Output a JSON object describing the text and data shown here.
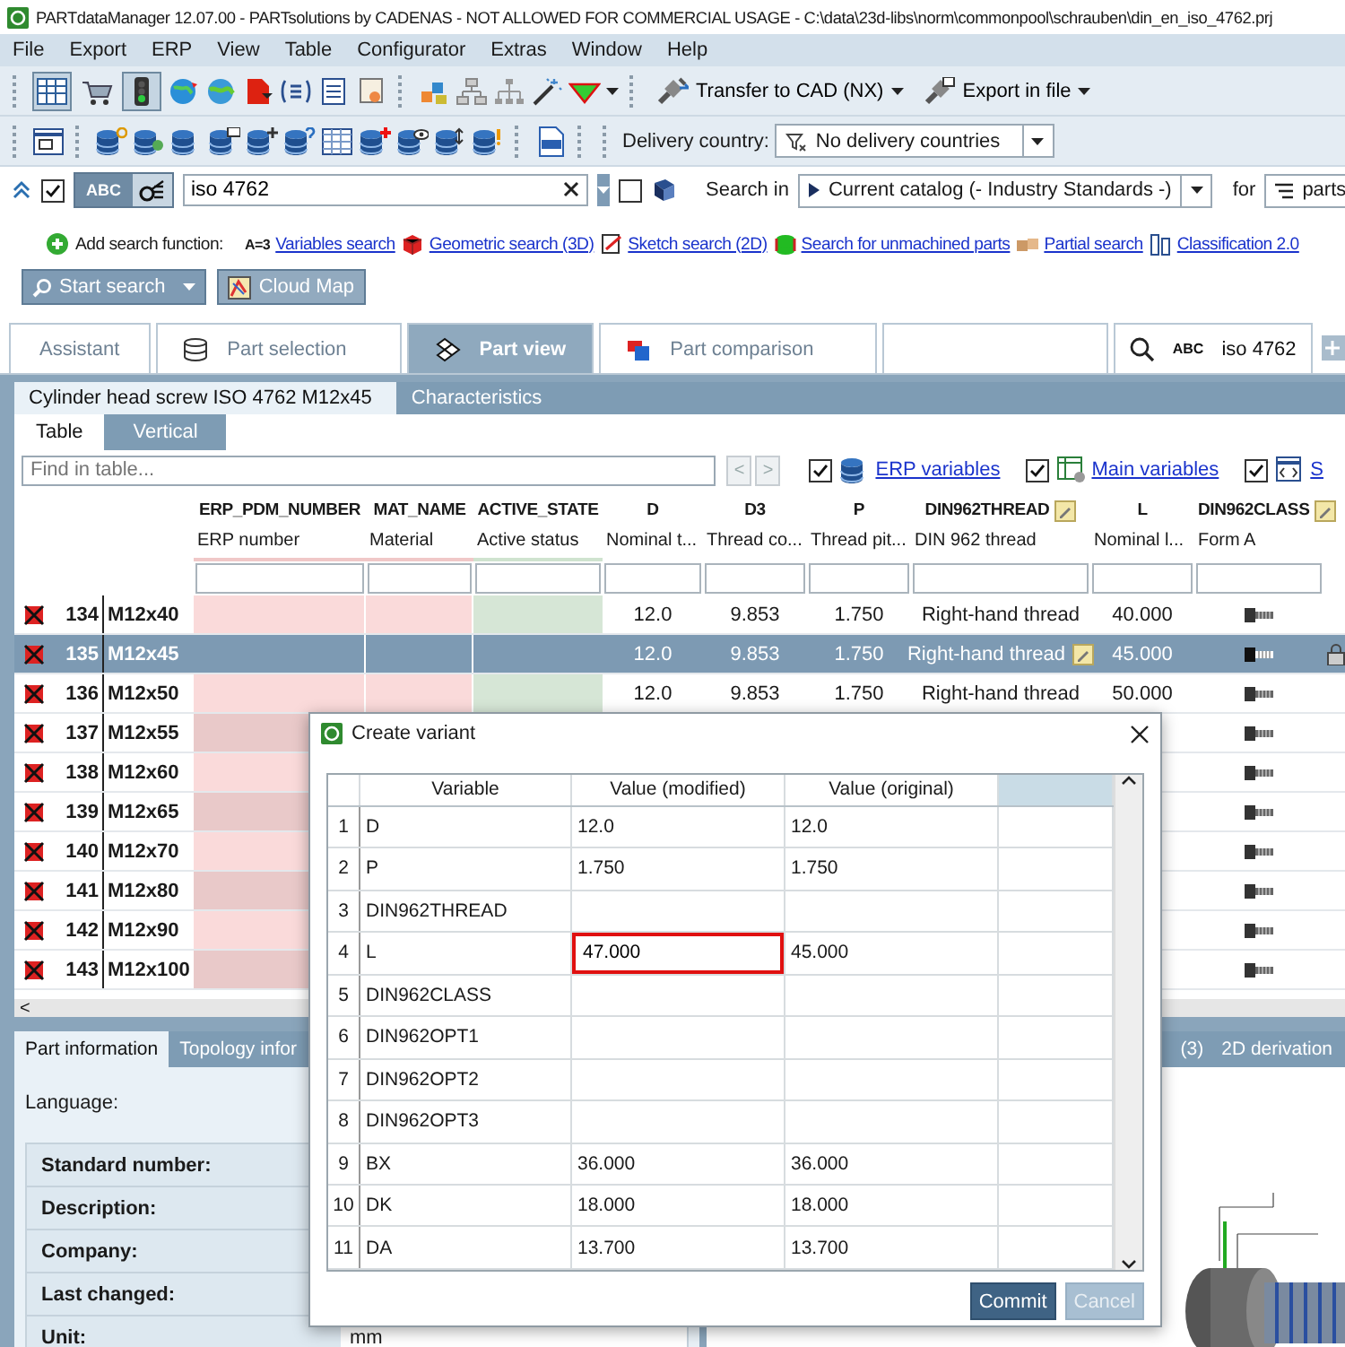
{
  "window": {
    "title": "PARTdataManager 12.07.00 - PARTsolutions by CADENAS - NOT ALLOWED FOR COMMERCIAL USAGE - C:\\data\\23d-libs\\norm\\commonpool\\schrauben\\din_en_iso_4762.prj"
  },
  "menu": [
    "File",
    "Export",
    "ERP",
    "View",
    "Table",
    "Configurator",
    "Extras",
    "Window",
    "Help"
  ],
  "toolbar": {
    "toggles": [
      {
        "pressed": true
      },
      {
        "pressed": false
      },
      {
        "pressed": true
      }
    ],
    "transfer_button": "Transfer to CAD (NX)",
    "export_button": "Export in file",
    "delivery_label": "Delivery country:",
    "delivery_value": "No delivery countries"
  },
  "search": {
    "checked": true,
    "abc_label": "ABC",
    "query": "iso 4762",
    "option_checked": false,
    "search_in_label": "Search in",
    "catalog": "Current catalog (- Industry Standards -)",
    "for_label": "for",
    "for_value": "parts"
  },
  "search_functions": {
    "label": "Add search function:",
    "links": [
      {
        "kind": "variables",
        "icon_text": "A=3",
        "label": "Variables search"
      },
      {
        "kind": "geometric",
        "label": "Geometric search (3D)"
      },
      {
        "kind": "sketch",
        "label": "Sketch search (2D)"
      },
      {
        "kind": "unmachined",
        "label": "Search for unmachined parts"
      },
      {
        "kind": "partial",
        "label": "Partial search"
      },
      {
        "kind": "classification",
        "label": "Classification 2.0"
      }
    ]
  },
  "action_buttons": [
    {
      "kind": "search",
      "label": "Start search"
    },
    {
      "kind": "map",
      "label": "Cloud Map"
    }
  ],
  "main_tabs": [
    {
      "kind": "text",
      "label": "Assistant",
      "selected": false
    },
    {
      "kind": "selection",
      "label": "Part selection",
      "selected": false
    },
    {
      "kind": "view",
      "label": "Part view",
      "selected": true
    },
    {
      "kind": "comparison",
      "label": "Part comparison",
      "selected": false
    },
    {
      "kind": "blank",
      "selected": false
    },
    {
      "kind": "search",
      "prefix": "ABC",
      "label": "iso 4762",
      "selected": false
    }
  ],
  "part_tabs": [
    {
      "label": "Cylinder head screw ISO 4762 M12x45",
      "selected": true
    },
    {
      "label": "Characteristics",
      "selected": false
    }
  ],
  "view_tabs": [
    {
      "label": "Table",
      "selected": true
    },
    {
      "label": "Vertical",
      "selected": false
    }
  ],
  "find": {
    "placeholder": "Find in table...",
    "prev": "<",
    "next": ">"
  },
  "filters": [
    {
      "kind": "erp",
      "label": "ERP variables",
      "checked": true
    },
    {
      "kind": "main",
      "label": "Main variables",
      "checked": true
    },
    {
      "kind": "code",
      "label": "S",
      "checked": true
    }
  ],
  "table": {
    "columns": [
      {
        "name": "ERP_PDM_NUMBER",
        "subtitle": "ERP number",
        "kind": "erp",
        "editable": false
      },
      {
        "name": "MAT_NAME",
        "subtitle": "Material",
        "kind": "erp",
        "editable": false
      },
      {
        "name": "ACTIVE_STATE",
        "subtitle": "Active status",
        "kind": "state",
        "editable": false
      },
      {
        "name": "D",
        "subtitle": "Nominal t...",
        "kind": "value",
        "editable": false
      },
      {
        "name": "D3",
        "subtitle": "Thread co...",
        "kind": "value",
        "editable": false
      },
      {
        "name": "P",
        "subtitle": "Thread pit...",
        "kind": "value",
        "editable": false
      },
      {
        "name": "DIN962THREAD",
        "subtitle": "DIN 962 thread",
        "kind": "value",
        "editable": true
      },
      {
        "name": "L",
        "subtitle": "Nominal l...",
        "kind": "value",
        "editable": false
      },
      {
        "name": "DIN962CLASS",
        "subtitle": "Form A",
        "kind": "icon",
        "editable": true
      }
    ],
    "rows": [
      {
        "number": "134",
        "name": "M12x40",
        "selected": false,
        "edited": false,
        "values": [
          "12.0",
          "9.853",
          "1.750",
          "Right-hand thread",
          "40.000"
        ]
      },
      {
        "number": "135",
        "name": "M12x45",
        "selected": true,
        "edited": true,
        "values": [
          "12.0",
          "9.853",
          "1.750",
          "Right-hand thread",
          "45.000"
        ]
      },
      {
        "number": "136",
        "name": "M12x50",
        "selected": false,
        "edited": false,
        "values": [
          "12.0",
          "9.853",
          "1.750",
          "Right-hand thread",
          "50.000"
        ]
      },
      {
        "number": "137",
        "name": "M12x55",
        "selected": false,
        "edited": false
      },
      {
        "number": "138",
        "name": "M12x60",
        "selected": false,
        "edited": false
      },
      {
        "number": "139",
        "name": "M12x65",
        "selected": false,
        "edited": false
      },
      {
        "number": "140",
        "name": "M12x70",
        "selected": false,
        "edited": false
      },
      {
        "number": "141",
        "name": "M12x80",
        "selected": false,
        "edited": false
      },
      {
        "number": "142",
        "name": "M12x90",
        "selected": false,
        "edited": false
      },
      {
        "number": "143",
        "name": "M12x100",
        "selected": false,
        "edited": false
      }
    ],
    "scroll_left": "<"
  },
  "info_tabs": [
    {
      "label": "Part information",
      "selected": true
    },
    {
      "label": "Topology infor",
      "selected": false
    },
    {
      "label": "(3)",
      "selected": false
    },
    {
      "label": "2D derivation",
      "selected": false
    }
  ],
  "info": {
    "language_label": "Language:",
    "fields": [
      {
        "label": "Standard number:"
      },
      {
        "label": "Description:"
      },
      {
        "label": "Company:"
      },
      {
        "label": "Last changed:"
      },
      {
        "label": "Unit:",
        "value": "mm"
      }
    ]
  },
  "dialog": {
    "title": "Create variant",
    "columns": [
      "Variable",
      "Value (modified)",
      "Value (original)"
    ],
    "rows": [
      {
        "index": "1",
        "variable": "D",
        "modified": "12.0",
        "original": "12.0",
        "editing": false
      },
      {
        "index": "2",
        "variable": "P",
        "modified": "1.750",
        "original": "1.750",
        "editing": false
      },
      {
        "index": "3",
        "variable": "DIN962THREAD",
        "editing": false
      },
      {
        "index": "4",
        "variable": "L",
        "modified": "47.000",
        "original": "45.000",
        "editing": true
      },
      {
        "index": "5",
        "variable": "DIN962CLASS",
        "editing": false
      },
      {
        "index": "6",
        "variable": "DIN962OPT1",
        "editing": false
      },
      {
        "index": "7",
        "variable": "DIN962OPT2",
        "editing": false
      },
      {
        "index": "8",
        "variable": "DIN962OPT3",
        "editing": false
      },
      {
        "index": "9",
        "variable": "BX",
        "modified": "36.000",
        "original": "36.000",
        "editing": false
      },
      {
        "index": "10",
        "variable": "DK",
        "modified": "18.000",
        "original": "18.000",
        "editing": false
      },
      {
        "index": "11",
        "variable": "DA",
        "modified": "13.700",
        "original": "13.700",
        "editing": false
      }
    ],
    "buttons": [
      {
        "kind": "primary",
        "label": "Commit",
        "disabled": false
      },
      {
        "kind": "secondary",
        "label": "Cancel",
        "disabled": true
      }
    ]
  }
}
